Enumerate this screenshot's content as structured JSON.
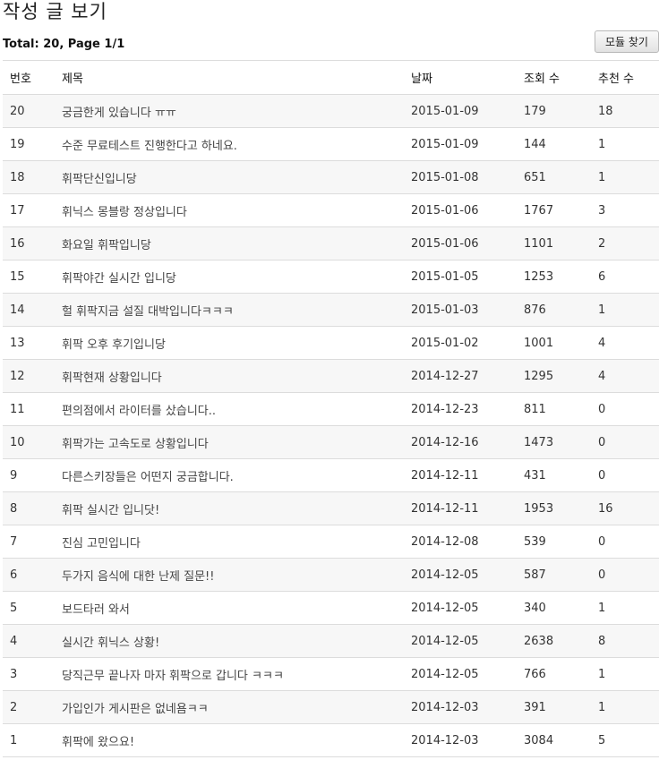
{
  "header": {
    "title": "작성 글 보기",
    "total": "Total: 20, Page 1/1",
    "module_button": "모듈 찾기"
  },
  "table": {
    "columns": [
      "번호",
      "제목",
      "날짜",
      "조회 수",
      "추천 수"
    ],
    "rows": [
      {
        "no": "20",
        "title": "궁금한게 있습니다 ㅠㅠ",
        "date": "2015-01-09",
        "views": "179",
        "rec": "18"
      },
      {
        "no": "19",
        "title": "수준 무료테스트 진행한다고 하네요.",
        "date": "2015-01-09",
        "views": "144",
        "rec": "1"
      },
      {
        "no": "18",
        "title": "휘팍단신입니당",
        "date": "2015-01-08",
        "views": "651",
        "rec": "1"
      },
      {
        "no": "17",
        "title": "휘닉스 몽블랑 정상입니다",
        "date": "2015-01-06",
        "views": "1767",
        "rec": "3"
      },
      {
        "no": "16",
        "title": "화요일 휘팍입니당",
        "date": "2015-01-06",
        "views": "1101",
        "rec": "2"
      },
      {
        "no": "15",
        "title": "휘팍야간 실시간 입니당",
        "date": "2015-01-05",
        "views": "1253",
        "rec": "6"
      },
      {
        "no": "14",
        "title": "헐 휘팍지금 설질 대박입니다ㅋㅋㅋ",
        "date": "2015-01-03",
        "views": "876",
        "rec": "1"
      },
      {
        "no": "13",
        "title": "휘팍 오후 후기입니당",
        "date": "2015-01-02",
        "views": "1001",
        "rec": "4"
      },
      {
        "no": "12",
        "title": "휘팍현재 상황입니다",
        "date": "2014-12-27",
        "views": "1295",
        "rec": "4"
      },
      {
        "no": "11",
        "title": "편의점에서 라이터를 샀습니다..",
        "date": "2014-12-23",
        "views": "811",
        "rec": "0"
      },
      {
        "no": "10",
        "title": "휘팍가는 고속도로 상황입니다",
        "date": "2014-12-16",
        "views": "1473",
        "rec": "0"
      },
      {
        "no": "9",
        "title": "다른스키장들은 어떤지 궁금합니다.",
        "date": "2014-12-11",
        "views": "431",
        "rec": "0"
      },
      {
        "no": "8",
        "title": "휘팍 실시간 입니닷!",
        "date": "2014-12-11",
        "views": "1953",
        "rec": "16"
      },
      {
        "no": "7",
        "title": "진심 고민입니다",
        "date": "2014-12-08",
        "views": "539",
        "rec": "0"
      },
      {
        "no": "6",
        "title": "두가지 음식에 대한 난제 질문!!",
        "date": "2014-12-05",
        "views": "587",
        "rec": "0"
      },
      {
        "no": "5",
        "title": "보드타러 와서",
        "date": "2014-12-05",
        "views": "340",
        "rec": "1"
      },
      {
        "no": "4",
        "title": "실시간 휘닉스 상황!",
        "date": "2014-12-05",
        "views": "2638",
        "rec": "8"
      },
      {
        "no": "3",
        "title": "당직근무 끝나자 마자 휘팍으로 갑니다 ㅋㅋㅋ",
        "date": "2014-12-05",
        "views": "766",
        "rec": "1"
      },
      {
        "no": "2",
        "title": "가입인가 게시판은 없네욤ㅋㅋ",
        "date": "2014-12-03",
        "views": "391",
        "rec": "1"
      },
      {
        "no": "1",
        "title": "휘팍에 왔으요!",
        "date": "2014-12-03",
        "views": "3084",
        "rec": "5"
      }
    ]
  }
}
